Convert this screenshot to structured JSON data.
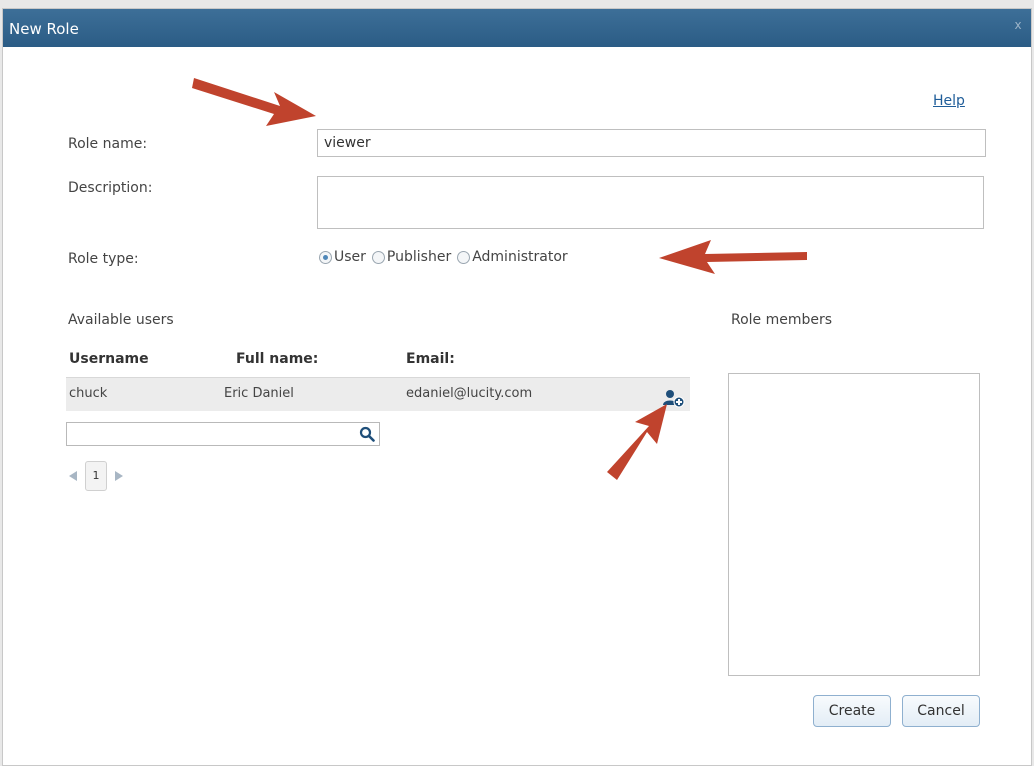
{
  "dialog": {
    "title": "New Role",
    "close_label": "x",
    "help_label": "Help"
  },
  "form": {
    "role_name_label": "Role name:",
    "role_name_value": "viewer",
    "description_label": "Description:",
    "description_value": "",
    "role_type_label": "Role type:",
    "role_types": [
      {
        "label": "User",
        "selected": true
      },
      {
        "label": "Publisher",
        "selected": false
      },
      {
        "label": "Administrator",
        "selected": false
      }
    ]
  },
  "available_users": {
    "title": "Available users",
    "columns": [
      "Username",
      "Full name:",
      "Email:"
    ],
    "rows": [
      {
        "username": "chuck",
        "full_name": "Eric Daniel",
        "email": "edaniel@lucity.com"
      }
    ],
    "search_value": "",
    "current_page": "1"
  },
  "role_members": {
    "title": "Role members"
  },
  "actions": {
    "create_label": "Create",
    "cancel_label": "Cancel"
  },
  "colors": {
    "titlebar": "#2b5c85",
    "annotation_arrow": "#c0432d",
    "link": "#1f5d99"
  },
  "icons": [
    "close-icon",
    "add-user-icon",
    "search-icon",
    "page-prev-icon",
    "page-next-icon"
  ]
}
